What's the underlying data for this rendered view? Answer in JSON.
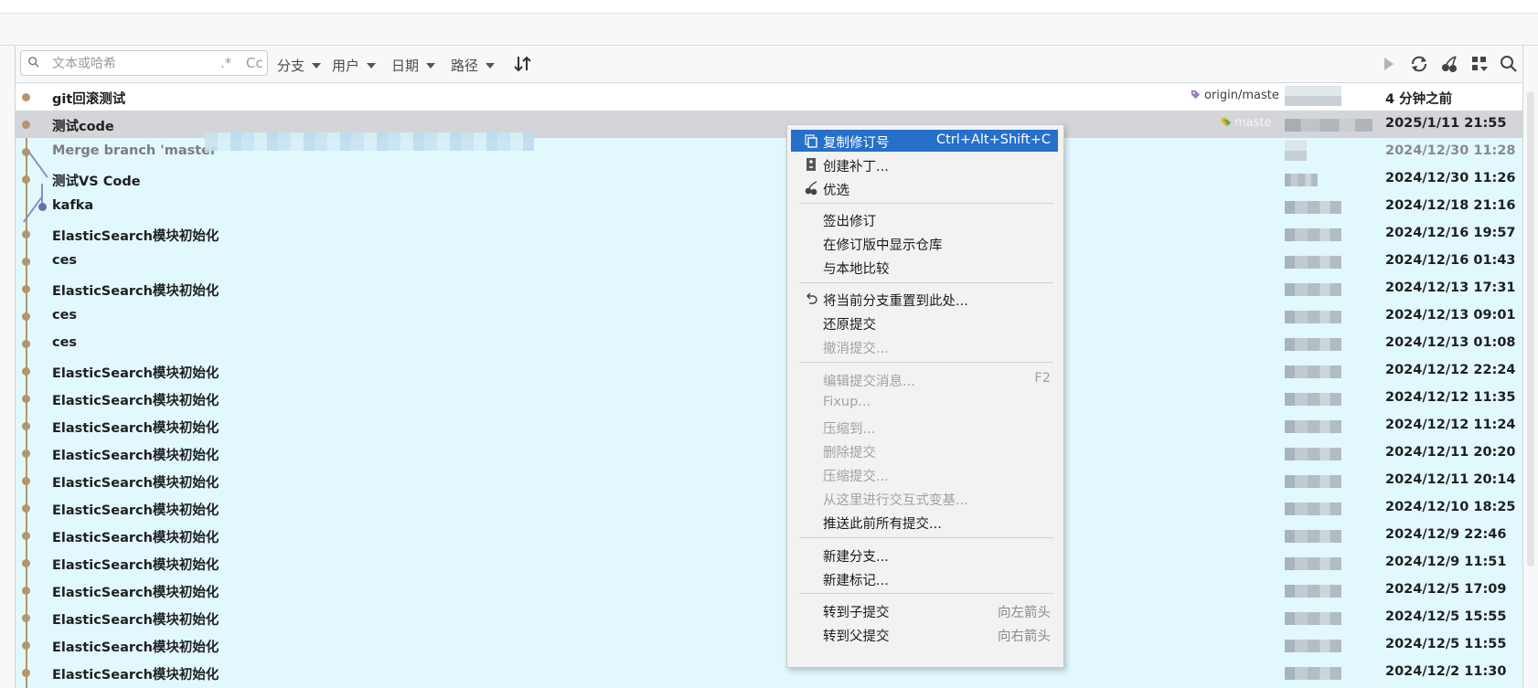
{
  "toolbar": {
    "search_placeholder": "文本或哈希",
    "regex_label": ".*",
    "case_label": "Cc",
    "filters": [
      "分支",
      "用户",
      "日期",
      "路径"
    ]
  },
  "commits": [
    {
      "message": "git回滚测试",
      "refs": "origin/maste",
      "date": "4 分钟之前"
    },
    {
      "message": "测试code",
      "refs": "maste",
      "date": "2025/1/11 21:55"
    },
    {
      "message": "Merge branch 'master",
      "date": "2024/12/30 11:28"
    },
    {
      "message": "测试VS Code",
      "date": "2024/12/30 11:26"
    },
    {
      "message": "kafka",
      "date": "2024/12/18 21:16"
    },
    {
      "message": "ElasticSearch模块初始化",
      "date": "2024/12/16 19:57"
    },
    {
      "message": "ces",
      "date": "2024/12/16 01:43"
    },
    {
      "message": "ElasticSearch模块初始化",
      "date": "2024/12/13 17:31"
    },
    {
      "message": "ces",
      "date": "2024/12/13 09:01"
    },
    {
      "message": "ces",
      "date": "2024/12/13 01:08"
    },
    {
      "message": "ElasticSearch模块初始化",
      "date": "2024/12/12 22:24"
    },
    {
      "message": "ElasticSearch模块初始化",
      "date": "2024/12/12 11:35"
    },
    {
      "message": "ElasticSearch模块初始化",
      "date": "2024/12/12 11:24"
    },
    {
      "message": "ElasticSearch模块初始化",
      "date": "2024/12/11 20:20"
    },
    {
      "message": "ElasticSearch模块初始化",
      "date": "2024/12/11 20:14"
    },
    {
      "message": "ElasticSearch模块初始化",
      "date": "2024/12/10 18:25"
    },
    {
      "message": "ElasticSearch模块初始化",
      "date": "2024/12/9 22:46"
    },
    {
      "message": "ElasticSearch模块初始化",
      "date": "2024/12/9 11:51"
    },
    {
      "message": "ElasticSearch模块初始化",
      "date": "2024/12/5 17:09"
    },
    {
      "message": "ElasticSearch模块初始化",
      "date": "2024/12/5 15:55"
    },
    {
      "message": "ElasticSearch模块初始化",
      "date": "2024/12/5 11:55"
    },
    {
      "message": "ElasticSearch模块初始化",
      "date": "2024/12/2 11:30"
    }
  ],
  "menu": {
    "copy_revision": {
      "label": "复制修订号",
      "shortcut": "Ctrl+Alt+Shift+C"
    },
    "create_patch": "创建补丁...",
    "cherry_pick": "优选",
    "checkout_revision": "签出修订",
    "show_repo_at_revision": "在修订版中显示仓库",
    "compare_local": "与本地比较",
    "reset_branch": "将当前分支重置到此处...",
    "revert_commit": "还原提交",
    "undo_commit": "撤消提交...",
    "edit_message": {
      "label": "编辑提交消息...",
      "shortcut": "F2"
    },
    "fixup": "Fixup...",
    "squash_into": "压缩到...",
    "drop_commit": "删除提交",
    "squash_commits": "压缩提交...",
    "interactive_rebase": "从这里进行交互式变基...",
    "push_all_before": "推送此前所有提交...",
    "new_branch": "新建分支...",
    "new_tag": "新建标记...",
    "go_child": {
      "label": "转到子提交",
      "shortcut": "向左箭头"
    },
    "go_parent": {
      "label": "转到父提交",
      "shortcut": "向右箭头"
    }
  },
  "colors": {
    "row_bg": "#e1f8fd",
    "selected_row": "#d3d5d8",
    "menu_highlight": "#2670c9",
    "graph_main": "#b3956c",
    "graph_branch": "#6c6caa"
  }
}
